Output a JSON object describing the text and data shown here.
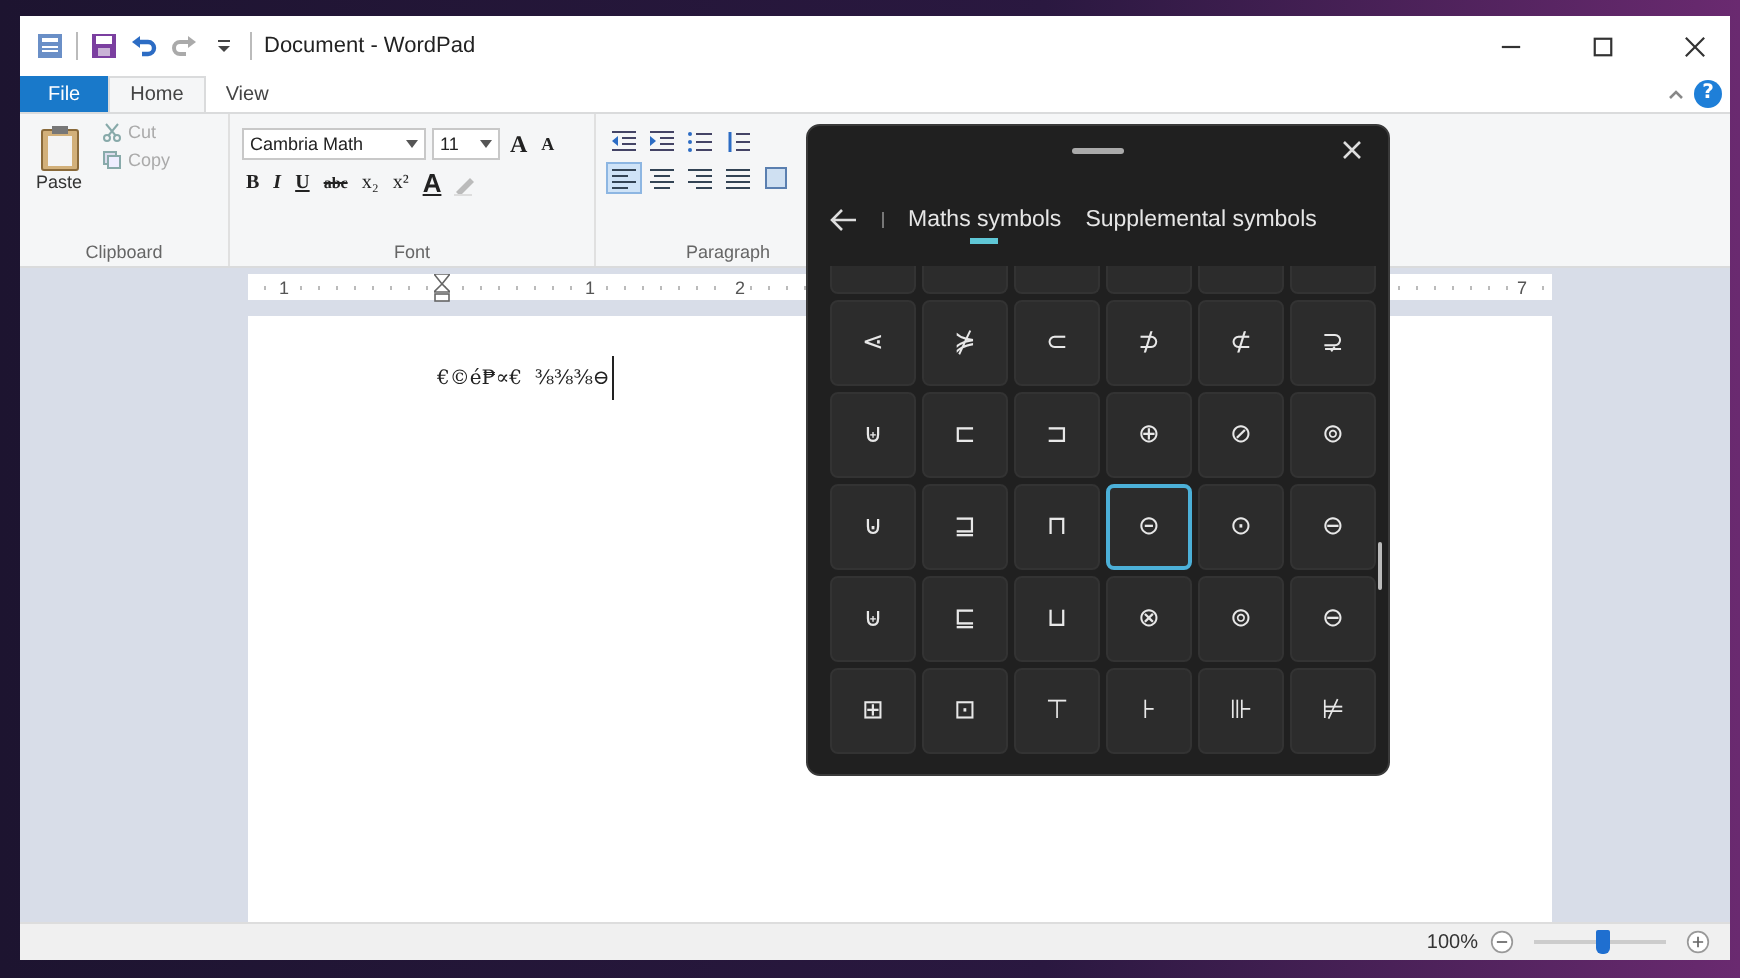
{
  "window": {
    "title": "Document - WordPad"
  },
  "ribbon_tabs": [
    {
      "label": "File",
      "kind": "file",
      "selected": false
    },
    {
      "label": "Home",
      "kind": "tab",
      "selected": true
    },
    {
      "label": "View",
      "kind": "tab",
      "selected": false
    }
  ],
  "clipboard": {
    "paste": "Paste",
    "cut": "Cut",
    "copy": "Copy",
    "group": "Clipboard"
  },
  "font": {
    "family": "Cambria Math",
    "size": "11",
    "grow_labels": [
      "A",
      "A"
    ],
    "format_buttons": [
      "B",
      "I",
      "U",
      "abc",
      "x₂",
      "x²"
    ],
    "color_label": "A",
    "group": "Font"
  },
  "paragraph": {
    "group": "Paragraph"
  },
  "ruler_labels": [
    "1",
    "1",
    "2",
    "7"
  ],
  "document": {
    "lines": [
      "€©é₱∝€  ⅜⅜⅜⊖"
    ]
  },
  "symbol_panel": {
    "tabs": [
      {
        "label": "Maths symbols",
        "selected": true
      },
      {
        "label": "Supplemental symbols",
        "selected": false
      }
    ],
    "rows": [
      [
        {
          "symbol": "⋖",
          "selected": false
        },
        {
          "symbol": "⋡",
          "selected": false
        },
        {
          "symbol": "⊂",
          "selected": false
        },
        {
          "symbol": "⊅",
          "selected": false
        },
        {
          "symbol": "⊄",
          "selected": false
        },
        {
          "symbol": "⊋",
          "selected": false
        }
      ],
      [
        {
          "symbol": "⊎",
          "selected": false
        },
        {
          "symbol": "⊏",
          "selected": false
        },
        {
          "symbol": "⊐",
          "selected": false
        },
        {
          "symbol": "⊕",
          "selected": false
        },
        {
          "symbol": "⊘",
          "selected": false
        },
        {
          "symbol": "⊚",
          "selected": false
        }
      ],
      [
        {
          "symbol": "⊍",
          "selected": false
        },
        {
          "symbol": "⊒",
          "selected": false
        },
        {
          "symbol": "⊓",
          "selected": false
        },
        {
          "symbol": "⊝",
          "selected": true
        },
        {
          "symbol": "⊙",
          "selected": false
        },
        {
          "symbol": "⊖",
          "selected": false
        }
      ],
      [
        {
          "symbol": "⊎",
          "selected": false
        },
        {
          "symbol": "⊑",
          "selected": false
        },
        {
          "symbol": "⊔",
          "selected": false
        },
        {
          "symbol": "⊗",
          "selected": false
        },
        {
          "symbol": "⊚",
          "selected": false
        },
        {
          "symbol": "⊖",
          "selected": false
        }
      ],
      [
        {
          "symbol": "⊞",
          "selected": false
        },
        {
          "symbol": "⊡",
          "selected": false
        },
        {
          "symbol": "⊤",
          "selected": false
        },
        {
          "symbol": "⊦",
          "selected": false
        },
        {
          "symbol": "⊪",
          "selected": false
        },
        {
          "symbol": "⊭",
          "selected": false
        }
      ]
    ]
  },
  "help": {
    "label": "?"
  },
  "status_bar": {
    "zoom": "100%",
    "zoom_slider": {
      "level": 0.52
    }
  }
}
